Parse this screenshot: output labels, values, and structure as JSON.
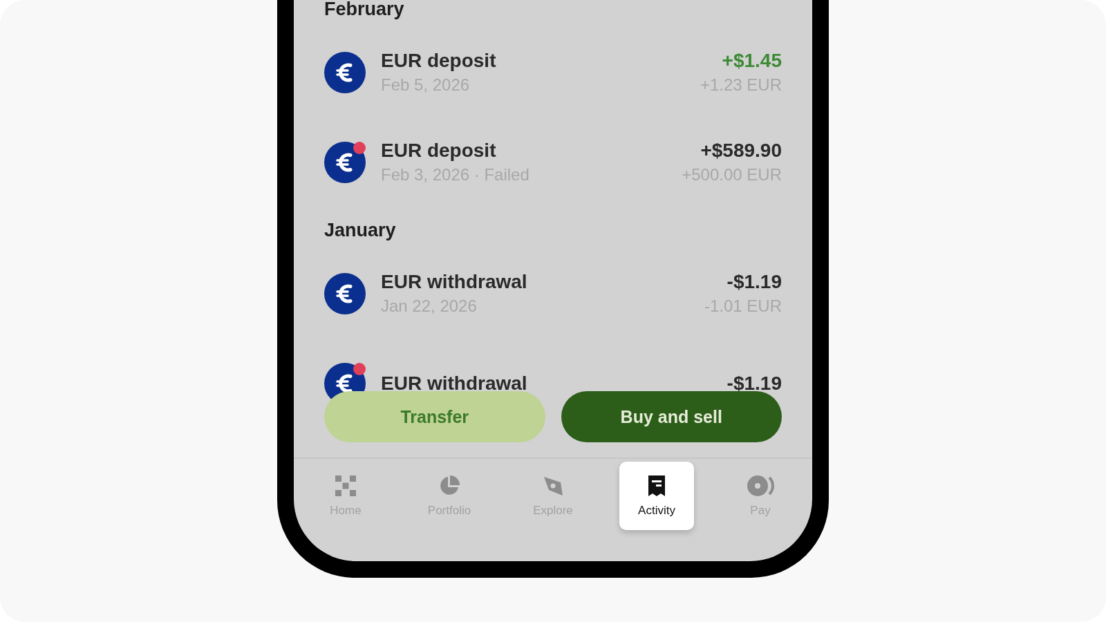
{
  "sections": [
    {
      "heading": "February",
      "transactions": [
        {
          "title": "EUR deposit",
          "date": "Feb 5, 2026",
          "amount": "+$1.45",
          "positive": true,
          "amount_eur": "+1.23 EUR",
          "failed": false
        },
        {
          "title": "EUR deposit",
          "date": "Feb 3, 2026 · Failed",
          "amount": "+$589.90",
          "positive": false,
          "amount_eur": "+500.00 EUR",
          "failed": true
        }
      ]
    },
    {
      "heading": "January",
      "transactions": [
        {
          "title": "EUR withdrawal",
          "date": "Jan 22, 2026",
          "amount": "-$1.19",
          "positive": false,
          "amount_eur": "-1.01 EUR",
          "failed": false
        },
        {
          "title": "EUR withdrawal",
          "amount": "-$1.19",
          "positive": false,
          "failed": true
        }
      ]
    }
  ],
  "actions": [
    {
      "label": "Transfer",
      "kind": "secondary"
    },
    {
      "label": "Buy and sell",
      "kind": "primary"
    }
  ],
  "nav": [
    {
      "label": "Home",
      "selected": false
    },
    {
      "label": "Portfolio",
      "selected": false
    },
    {
      "label": "Explore",
      "selected": false
    },
    {
      "label": "Activity",
      "selected": true
    },
    {
      "label": "Pay",
      "selected": false
    }
  ]
}
